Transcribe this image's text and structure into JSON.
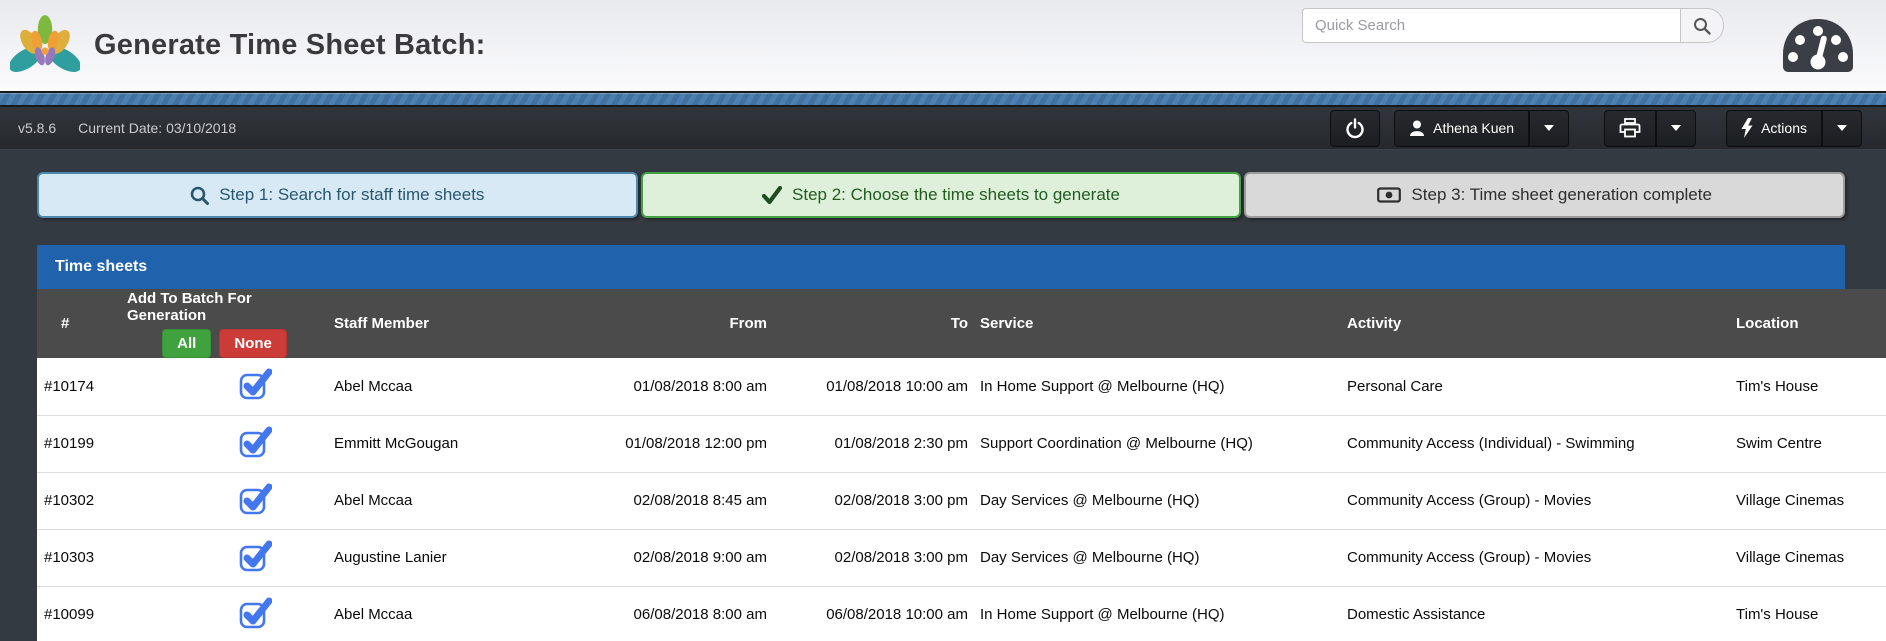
{
  "header": {
    "title": "Generate Time Sheet Batch:",
    "search_placeholder": "Quick Search"
  },
  "nav": {
    "version": "v5.8.6",
    "current_date": "Current Date: 03/10/2018",
    "user_name": "Athena Kuen",
    "actions_label": "Actions"
  },
  "steps": [
    {
      "label": "Step 1: Search for staff time sheets"
    },
    {
      "label": "Step 2: Choose the time sheets to generate"
    },
    {
      "label": "Step 3: Time sheet generation complete"
    }
  ],
  "panel": {
    "title": "Time sheets",
    "batch_header": "Add To Batch For Generation",
    "all_label": "All",
    "none_label": "None",
    "columns": {
      "id": "#",
      "staff": "Staff Member",
      "from": "From",
      "to": "To",
      "service": "Service",
      "activity": "Activity",
      "location": "Location"
    }
  },
  "rows": [
    {
      "id": "#10174",
      "checked": true,
      "staff": "Abel Mccaa",
      "from": "01/08/2018 8:00 am",
      "to": "01/08/2018 10:00 am",
      "service": "In Home Support @ Melbourne (HQ)",
      "activity": "Personal Care",
      "location": "Tim's House"
    },
    {
      "id": "#10199",
      "checked": true,
      "staff": "Emmitt McGougan",
      "from": "01/08/2018 12:00 pm",
      "to": "01/08/2018 2:30 pm",
      "service": "Support Coordination @ Melbourne (HQ)",
      "activity": "Community Access (Individual) - Swimming",
      "location": "Swim Centre"
    },
    {
      "id": "#10302",
      "checked": true,
      "staff": "Abel Mccaa",
      "from": "02/08/2018 8:45 am",
      "to": "02/08/2018 3:00 pm",
      "service": "Day Services @ Melbourne (HQ)",
      "activity": "Community Access (Group) - Movies",
      "location": "Village Cinemas"
    },
    {
      "id": "#10303",
      "checked": true,
      "staff": "Augustine Lanier",
      "from": "02/08/2018 9:00 am",
      "to": "02/08/2018 3:00 pm",
      "service": "Day Services @ Melbourne (HQ)",
      "activity": "Community Access (Group) - Movies",
      "location": "Village Cinemas"
    },
    {
      "id": "#10099",
      "checked": true,
      "staff": "Abel Mccaa",
      "from": "06/08/2018 8:00 am",
      "to": "06/08/2018 10:00 am",
      "service": "In Home Support @ Melbourne (HQ)",
      "activity": "Domestic Assistance",
      "location": "Tim's House"
    }
  ],
  "icons": {
    "logo": "lotus-flower",
    "search": "magnifier",
    "dashboard": "speedometer-gauge",
    "power": "power-symbol",
    "user": "person-silhouette",
    "print": "printer",
    "actions": "lightning-bolt",
    "dropdown": "caret-down",
    "step1": "magnifier",
    "step2": "checkmark",
    "step3": "banknote",
    "row_select": "blue-checkbox-checked"
  },
  "colors": {
    "panel_blue": "#2063ac",
    "table_header_gray": "#4b4b4b",
    "step1_bg": "#d7e9f5",
    "step1_border": "#4d87ab",
    "step2_bg": "#dff0da",
    "step2_border": "#44a044",
    "step3_bg": "#d9d9d9",
    "all_green": "#3fa23f",
    "none_red": "#cb3b37",
    "checkbox_blue": "#4377f0",
    "nav_dark": "#27292e",
    "page_dark_bg": "#343a41"
  }
}
